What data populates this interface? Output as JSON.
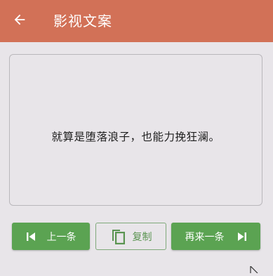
{
  "app_bar": {
    "title": "影视文案",
    "back_icon": "arrow-left-icon",
    "background": "#d27157"
  },
  "content": {
    "quote": "就算是堕落浪子，也能力挽狂澜。"
  },
  "buttons": {
    "prev_label": "上一条",
    "prev_icon": "skip-previous-icon",
    "copy_label": "复制",
    "copy_icon": "copy-icon",
    "next_label": "再来一条",
    "next_icon": "skip-next-icon"
  },
  "colors": {
    "accent": "#d27157",
    "button_green": "#5ba352",
    "background": "#e8e5e9"
  }
}
